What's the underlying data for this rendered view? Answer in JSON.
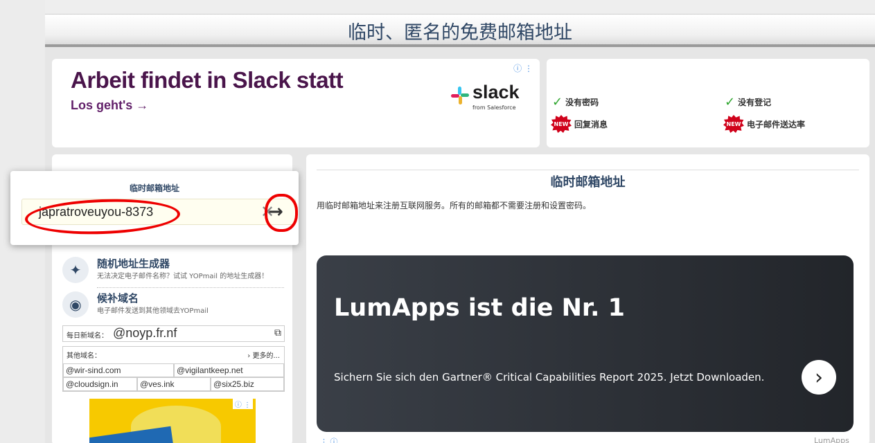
{
  "header": {
    "title": "临时、匿名的免费邮箱地址"
  },
  "ad_slack": {
    "headline": "Arbeit findet in Slack statt",
    "cta": "Los geht's →",
    "brand": "slack",
    "brand_sub": "from Salesforce",
    "info": "ⓘ ⋮"
  },
  "features": {
    "no_password": "没有密码",
    "no_signup": "没有登记",
    "reply": "回复消息",
    "deliverability": "电子邮件送达率",
    "new_badge": "NEW"
  },
  "login": {
    "label": "临时邮箱地址",
    "value": "japratroveuyou-8373",
    "clear": "✕",
    "go": "→"
  },
  "tools": [
    {
      "title": "随机地址生成器",
      "sub": "无法决定电子邮件名称？试试 YOPmail 的地址生成器！"
    },
    {
      "title": "候补域名",
      "sub": "电子邮件发送到其他领域去YOPmail"
    }
  ],
  "daily": {
    "label": "每日新域名：",
    "value": "@noyp.fr.nf"
  },
  "others": {
    "label": "其他域名：",
    "more": "› 更多的...",
    "domains": [
      "@wir-sind.com",
      "@vigilantkeep.net",
      "@cloudsign.in",
      "@ves.ink",
      "@six25.biz"
    ]
  },
  "main": {
    "title": "临时邮箱地址",
    "desc": "用临时邮箱地址来注册互联网服务。所有的邮箱都不需要注册和设置密码。"
  },
  "ad_lumapps": {
    "headline": "LumApps ist die Nr. 1",
    "sub": "Sichern Sie sich den Gartner® Critical Capabilities Report 2025. Jetzt Downloaden.",
    "arrow": "›",
    "footer": "LumApps"
  }
}
